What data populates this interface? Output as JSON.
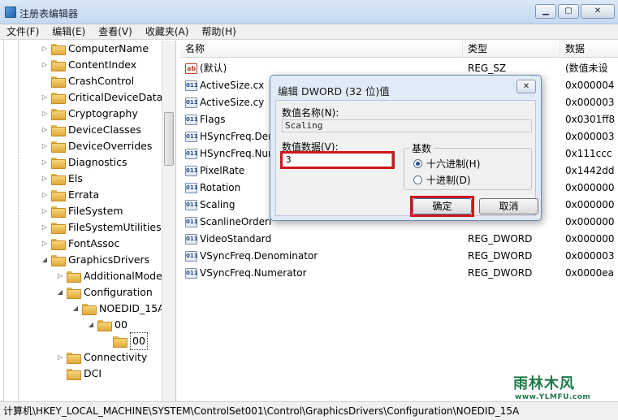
{
  "window": {
    "title": "注册表编辑器",
    "minimize": "▁",
    "maximize": "▢",
    "close": "✕"
  },
  "menu": [
    "文件(F)",
    "编辑(E)",
    "查看(V)",
    "收藏夹(A)",
    "帮助(H)"
  ],
  "tree": [
    {
      "label": "ComputerName",
      "indent": 0,
      "expander": "▷"
    },
    {
      "label": "ContentIndex",
      "indent": 0,
      "expander": "▷"
    },
    {
      "label": "CrashControl",
      "indent": 0,
      "expander": ""
    },
    {
      "label": "CriticalDeviceDatab",
      "indent": 0,
      "expander": "▷"
    },
    {
      "label": "Cryptography",
      "indent": 0,
      "expander": "▷"
    },
    {
      "label": "DeviceClasses",
      "indent": 0,
      "expander": "▷"
    },
    {
      "label": "DeviceOverrides",
      "indent": 0,
      "expander": "▷"
    },
    {
      "label": "Diagnostics",
      "indent": 0,
      "expander": "▷"
    },
    {
      "label": "Els",
      "indent": 0,
      "expander": "▷"
    },
    {
      "label": "Errata",
      "indent": 0,
      "expander": "▷"
    },
    {
      "label": "FileSystem",
      "indent": 0,
      "expander": "▷"
    },
    {
      "label": "FileSystemUtilities",
      "indent": 0,
      "expander": "▷"
    },
    {
      "label": "FontAssoc",
      "indent": 0,
      "expander": "▷"
    },
    {
      "label": "GraphicsDrivers",
      "indent": 0,
      "expander": "◢"
    },
    {
      "label": "AdditionalMode",
      "indent": 1,
      "expander": "▷"
    },
    {
      "label": "Configuration",
      "indent": 1,
      "expander": "◢"
    },
    {
      "label": "NOEDID_15A",
      "indent": 2,
      "expander": "◢"
    },
    {
      "label": "00",
      "indent": 3,
      "expander": "◢"
    },
    {
      "label": "00",
      "indent": 4,
      "expander": "",
      "selected": true
    },
    {
      "label": "Connectivity",
      "indent": 1,
      "expander": "▷"
    },
    {
      "label": "DCI",
      "indent": 1,
      "expander": ""
    }
  ],
  "list": {
    "headers": {
      "name": "名称",
      "type": "类型",
      "data": "数据"
    },
    "rows": [
      {
        "name": "(默认)",
        "type": "REG_SZ",
        "data": "(数值未设",
        "icon": "ab"
      },
      {
        "name": "ActiveSize.cx",
        "type": "",
        "data": "0x000004",
        "icon": "011"
      },
      {
        "name": "ActiveSize.cy",
        "type": "",
        "data": "0x000003",
        "icon": "011"
      },
      {
        "name": "Flags",
        "type": "",
        "data": "0x0301ff8",
        "icon": "011"
      },
      {
        "name": "HSyncFreq.Den",
        "type": "",
        "data": "0x000003",
        "icon": "011"
      },
      {
        "name": "HSyncFreq.Nur",
        "type": "",
        "data": "0x111ccc",
        "icon": "011"
      },
      {
        "name": "PixelRate",
        "type": "",
        "data": "0x1442dd",
        "icon": "011"
      },
      {
        "name": "Rotation",
        "type": "",
        "data": "0x000000",
        "icon": "011"
      },
      {
        "name": "Scaling",
        "type": "",
        "data": "0x000000",
        "icon": "011"
      },
      {
        "name": "ScanlineOrderi",
        "type": "",
        "data": "0x000000",
        "icon": "011"
      },
      {
        "name": "VideoStandard",
        "type": "REG_DWORD",
        "data": "0x000000",
        "icon": "011"
      },
      {
        "name": "VSyncFreq.Denominator",
        "type": "REG_DWORD",
        "data": "0x000003",
        "icon": "011"
      },
      {
        "name": "VSyncFreq.Numerator",
        "type": "REG_DWORD",
        "data": "0x0000ea",
        "icon": "011"
      }
    ]
  },
  "status": "计算机\\HKEY_LOCAL_MACHINE\\SYSTEM\\ControlSet001\\Control\\GraphicsDrivers\\Configuration\\NOEDID_15A",
  "dialog": {
    "title": "编辑 DWORD (32 位)值",
    "close": "✕",
    "name_label": "数值名称(N):",
    "name_value": "Scaling",
    "data_label": "数值数据(V):",
    "data_value": "3",
    "base_label": "基数",
    "hex_label": "十六进制(H)",
    "dec_label": "十进制(D)",
    "ok": "确定",
    "cancel": "取消"
  },
  "watermark": {
    "main": "雨林木风",
    "url": "www.YLMFU.com"
  },
  "colors": {
    "highlight_box": "#d0161b",
    "titlebar": "#c4d9f1"
  }
}
